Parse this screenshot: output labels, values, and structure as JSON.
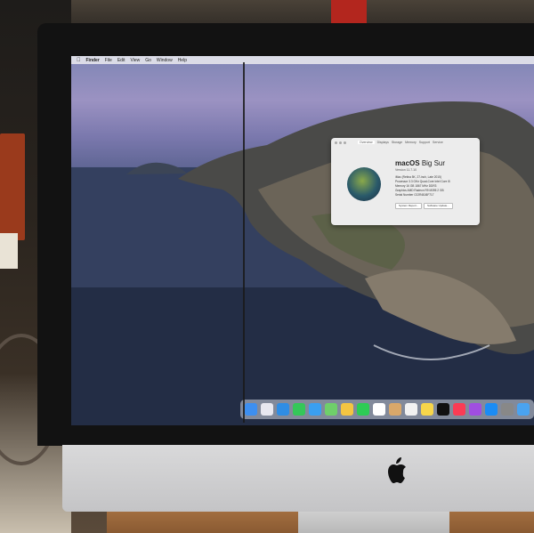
{
  "menubar": {
    "apple_icon": "apple-icon",
    "items": [
      "Finder",
      "File",
      "Edit",
      "View",
      "Go",
      "Window",
      "Help"
    ]
  },
  "about_window": {
    "tabs": [
      "Overview",
      "Displays",
      "Storage",
      "Memory",
      "Support",
      "Service"
    ],
    "os_name": "macOS",
    "os_codename": "Big Sur",
    "version": "Version 11.7.10",
    "specs": [
      "iMac (Retina 5K, 27-inch, Late 2015)",
      "Processor  3.3 GHz Quad-Core Intel Core i5",
      "Memory  16 GB 1867 MHz DDR3",
      "Graphics  AMD Radeon R9 M395 2 GB",
      "Serial Number  C02R48J6F717"
    ],
    "buttons": [
      "System Report...",
      "Software Update..."
    ]
  },
  "dock": {
    "icons": [
      {
        "name": "finder-icon",
        "color": "#3d8ff0"
      },
      {
        "name": "launchpad-icon",
        "color": "#e8e8f0"
      },
      {
        "name": "safari-icon",
        "color": "#2f8de4"
      },
      {
        "name": "messages-icon",
        "color": "#34c759"
      },
      {
        "name": "mail-icon",
        "color": "#3a9ff0"
      },
      {
        "name": "maps-icon",
        "color": "#6fcf6a"
      },
      {
        "name": "photos-icon",
        "color": "#f4c542"
      },
      {
        "name": "facetime-icon",
        "color": "#2ecc55"
      },
      {
        "name": "calendar-icon",
        "color": "#ffffff"
      },
      {
        "name": "contacts-icon",
        "color": "#d9a86a"
      },
      {
        "name": "reminders-icon",
        "color": "#f2f2f2"
      },
      {
        "name": "notes-icon",
        "color": "#f7d64a"
      },
      {
        "name": "tv-icon",
        "color": "#111111"
      },
      {
        "name": "music-icon",
        "color": "#fa3c55"
      },
      {
        "name": "podcasts-icon",
        "color": "#a04ee0"
      },
      {
        "name": "app-store-icon",
        "color": "#1b8cf5"
      },
      {
        "name": "system-preferences-icon",
        "color": "#888888"
      },
      {
        "name": "downloads-folder-icon",
        "color": "#4aa3f0"
      }
    ]
  },
  "room": {
    "sign_text": ""
  }
}
